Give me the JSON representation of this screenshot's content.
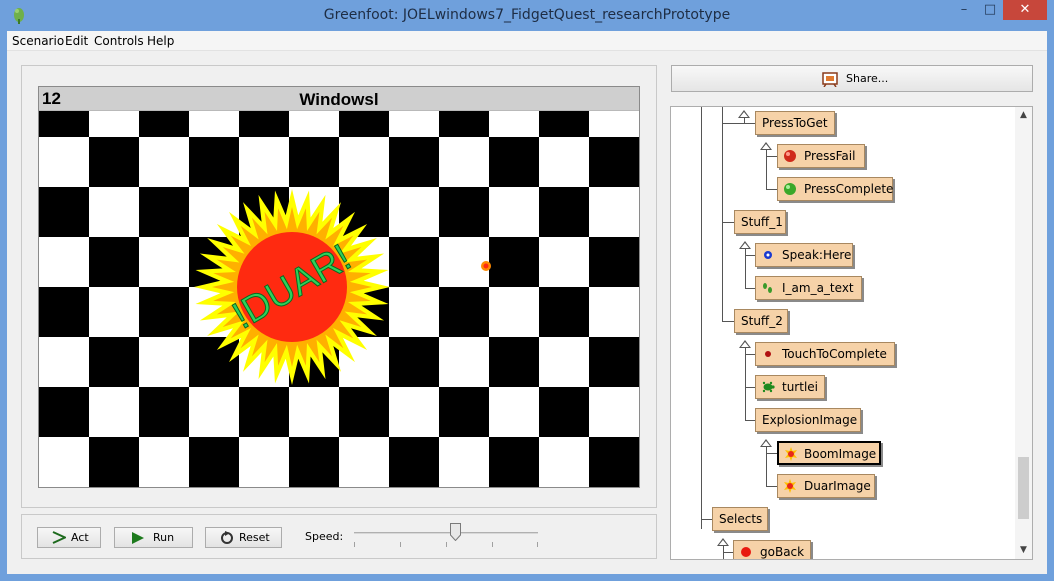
{
  "window": {
    "title": "Greenfoot: JOELwindows7_FidgetQuest_researchPrototype",
    "minimize": "–",
    "maximize": "□",
    "close": "✕"
  },
  "menu": [
    "Scenario",
    "Edit",
    "Controls",
    "Help"
  ],
  "world": {
    "counter": "12",
    "title": "Windowsl",
    "explosion_text": "!DUAR!"
  },
  "controls": {
    "act": "Act",
    "run": "Run",
    "reset": "Reset",
    "speed_label": "Speed:",
    "speed": 0.55
  },
  "share": {
    "label": "Share..."
  },
  "tree": {
    "classes": [
      {
        "name": "PressToGet",
        "icon": "none"
      },
      {
        "name": "PressFail",
        "icon": "red-ball-icon"
      },
      {
        "name": "PressComplete",
        "icon": "green-ball-icon"
      },
      {
        "name": "Stuff_1",
        "icon": "none"
      },
      {
        "name": "Speak:Here",
        "icon": "blue-dot-icon"
      },
      {
        "name": "I_am_a_text",
        "icon": "footprints-icon"
      },
      {
        "name": "Stuff_2",
        "icon": "none"
      },
      {
        "name": "TouchToComplete",
        "icon": "red-dot-icon"
      },
      {
        "name": "turtlei",
        "icon": "turtle-icon"
      },
      {
        "name": "ExplosionImage",
        "icon": "none"
      },
      {
        "name": "BoomImage",
        "icon": "explosion-icon"
      },
      {
        "name": "DuarImage",
        "icon": "explosion-icon"
      },
      {
        "name": "Selects",
        "icon": "none"
      },
      {
        "name": "goBack",
        "icon": "red-ball-icon"
      }
    ],
    "selected": "BoomImage"
  },
  "colors": {
    "title_bar": "#6fa0dc",
    "class_box": "#f6d2a8",
    "close_button": "#c7473b"
  }
}
